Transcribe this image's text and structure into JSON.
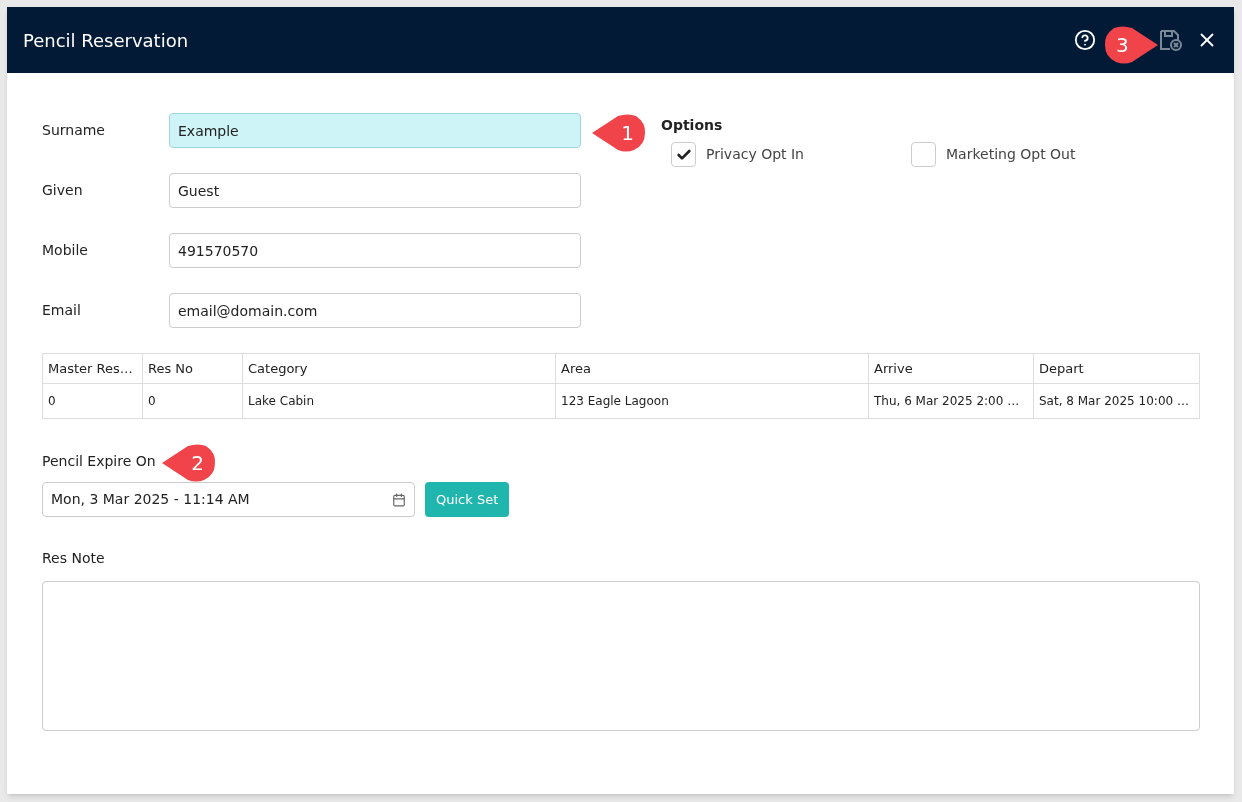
{
  "window": {
    "title": "Pencil Reservation"
  },
  "fields": [
    {
      "label": "Surname",
      "value": "Example",
      "highlighted": true
    },
    {
      "label": "Given",
      "value": "Guest",
      "highlighted": false
    },
    {
      "label": "Mobile",
      "value": "491570570",
      "highlighted": false
    },
    {
      "label": "Email",
      "value": "email@domain.com",
      "highlighted": false
    }
  ],
  "options": {
    "title": "Options",
    "items": [
      {
        "label": "Privacy Opt In",
        "checked": true
      },
      {
        "label": "Marketing Opt Out",
        "checked": false
      }
    ]
  },
  "table": {
    "columns": [
      "Master Res…",
      "Res No",
      "Category",
      "Area",
      "Arrive",
      "Depart"
    ],
    "rows": [
      [
        "0",
        "0",
        "Lake Cabin",
        "123 Eagle Lagoon",
        "Thu, 6 Mar 2025 2:00 …",
        "Sat, 8 Mar 2025 10:00 …"
      ]
    ]
  },
  "pencil_expire": {
    "label": "Pencil Expire On",
    "value": "Mon, 3 Mar 2025 - 11:14 AM",
    "button": "Quick Set"
  },
  "res_note": {
    "label": "Res Note"
  },
  "callouts": [
    {
      "number": "1",
      "kind": "left"
    },
    {
      "number": "2",
      "kind": "left"
    },
    {
      "number": "3",
      "kind": "right"
    }
  ]
}
